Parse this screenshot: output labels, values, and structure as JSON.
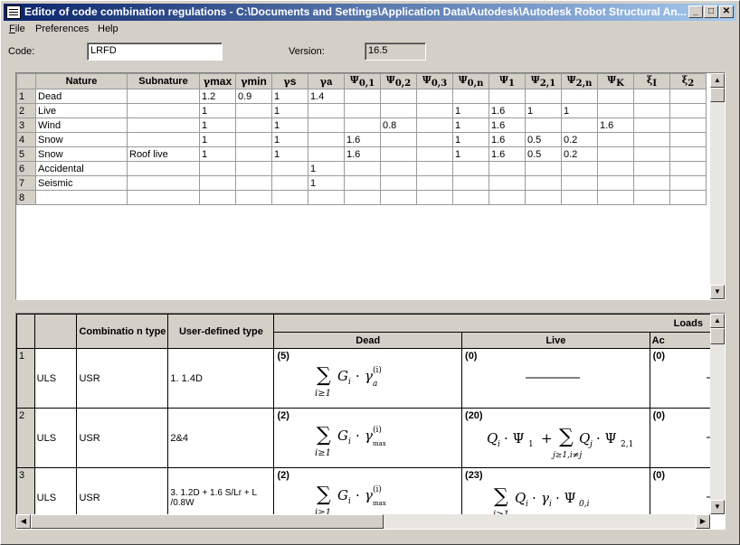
{
  "window": {
    "title": "Editor of code combination regulations - C:\\Documents and Settings\\Application Data\\Autodesk\\Autodesk Robot Structural An..."
  },
  "menu": [
    {
      "label": "File",
      "ul": "F",
      "rest": "ile"
    },
    {
      "label": "Preferences",
      "ul": "",
      "rest": "Preferences"
    },
    {
      "label": "Help",
      "ul": "",
      "rest": "Help"
    }
  ],
  "form": {
    "code_label": "Code:",
    "code_value": "LRFD",
    "version_label": "Version:",
    "version_value": "16.5"
  },
  "grid1": {
    "headers": [
      "Nature",
      "Subnature",
      "γmax",
      "γmin",
      "γs",
      "γa",
      "Ψ0,1",
      "Ψ0,2",
      "Ψ0,3",
      "Ψ0,n",
      "Ψ1",
      "Ψ2,1",
      "Ψ2,n",
      "ΨK",
      "ξI",
      "ξ2"
    ],
    "rows": [
      [
        "1",
        "Dead",
        "",
        "1.2",
        "0.9",
        "1",
        "1.4",
        "",
        "",
        "",
        "",
        "",
        "",
        "",
        "",
        "",
        ""
      ],
      [
        "2",
        "Live",
        "",
        "1",
        "",
        "1",
        "",
        "",
        "",
        "",
        "1",
        "1.6",
        "1",
        "1",
        "",
        "",
        ""
      ],
      [
        "3",
        "Wind",
        "",
        "1",
        "",
        "1",
        "",
        "",
        "0.8",
        "",
        "1",
        "1.6",
        "",
        "",
        "1.6",
        "",
        ""
      ],
      [
        "4",
        "Snow",
        "",
        "1",
        "",
        "1",
        "",
        "1.6",
        "",
        "",
        "1",
        "1.6",
        "0.5",
        "0.2",
        "",
        "",
        ""
      ],
      [
        "5",
        "Snow",
        "Roof live",
        "1",
        "",
        "1",
        "",
        "1.6",
        "",
        "",
        "1",
        "1.6",
        "0.5",
        "0.2",
        "",
        "",
        ""
      ],
      [
        "6",
        "Accidental",
        "",
        "",
        "",
        "",
        "1",
        "",
        "",
        "",
        "",
        "",
        "",
        "",
        "",
        "",
        ""
      ],
      [
        "7",
        "Seismic",
        "",
        "",
        "",
        "",
        "1",
        "",
        "",
        "",
        "",
        "",
        "",
        "",
        "",
        "",
        ""
      ],
      [
        "8",
        "",
        "",
        "",
        "",
        "",
        "",
        "",
        "",
        "",
        "",
        "",
        "",
        "",
        "",
        "",
        ""
      ]
    ]
  },
  "grid2": {
    "col_combination_type": "Combinatio n type",
    "col_user_type": "User-defined type",
    "loads_header": "Loads",
    "load_cols": [
      "Dead",
      "Live",
      "Ac"
    ],
    "rows": [
      {
        "num": "1",
        "limit": "ULS",
        "ctype": "USR",
        "utype": "1. 1.4D",
        "dead_count": "(5)",
        "live_count": "(0)",
        "acc_count": "(0)"
      },
      {
        "num": "2",
        "limit": "ULS",
        "ctype": "USR",
        "utype": "2&4",
        "dead_count": "(2)",
        "live_count": "(20)",
        "acc_count": "(0)"
      },
      {
        "num": "3",
        "limit": "ULS",
        "ctype": "USR",
        "utype": "3. 1.2D + 1.6 S/Lr + L /0.8W",
        "dead_count": "(2)",
        "live_count": "(23)",
        "acc_count": "(0)"
      }
    ]
  }
}
